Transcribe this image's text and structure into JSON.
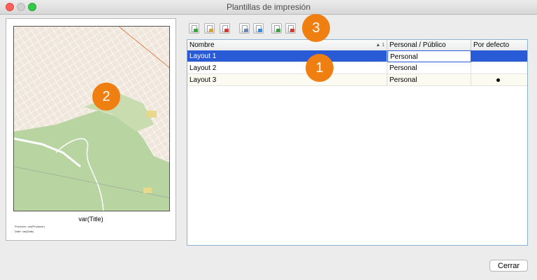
{
  "window": {
    "title": "Plantillas de impresión"
  },
  "preview": {
    "title": "var(Title)",
    "producer": "Producer: var(Producer)",
    "date": "Date: var(Date)"
  },
  "toolbar": {
    "buttons": [
      {
        "icon": "new-template-icon",
        "accent": "#3aa53a"
      },
      {
        "icon": "edit-template-icon",
        "accent": "#d6a23a"
      },
      {
        "icon": "delete-template-icon",
        "accent": "#d33a2c"
      },
      {
        "icon": "duplicate-template-icon",
        "accent": "#6a86b0"
      },
      {
        "icon": "rename-template-icon",
        "accent": "#3a8ad6"
      },
      {
        "icon": "import-template-icon",
        "accent": "#3aa53a"
      },
      {
        "icon": "export-template-icon",
        "accent": "#d33a2c"
      }
    ]
  },
  "table": {
    "columns": [
      "Nombre",
      "Personal / Público",
      "Por defecto"
    ],
    "sort_indicator": "▲ 1",
    "rows": [
      {
        "name": "Layout 1",
        "scope": "Personal",
        "default": false,
        "selected": true
      },
      {
        "name": "Layout 2",
        "scope": "Personal",
        "default": false,
        "selected": false
      },
      {
        "name": "Layout 3",
        "scope": "Personal",
        "default": true,
        "selected": false
      }
    ]
  },
  "callouts": [
    "1",
    "2",
    "3"
  ],
  "footer": {
    "close_label": "Cerrar"
  },
  "colors": {
    "accent": "#f07f12",
    "selection": "#2a5bd7",
    "map_park": "#b7d4a1"
  }
}
